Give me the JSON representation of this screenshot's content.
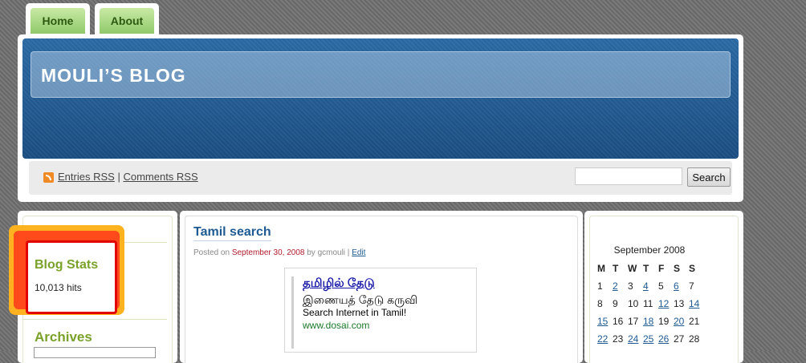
{
  "nav": {
    "tabs": [
      {
        "label": "Home"
      },
      {
        "label": "About"
      }
    ]
  },
  "header": {
    "title": "MOULI’S BLOG",
    "entries_rss": "Entries RSS",
    "separator": "|",
    "comments_rss": "Comments RSS",
    "search_button": "Search",
    "search_placeholder": ""
  },
  "sidebar_left": {
    "stats_title": "Blog Stats",
    "hits": "10,013 hits",
    "archives_title": "Archives"
  },
  "post": {
    "title": "Tamil search",
    "meta_prefix": "Posted on",
    "date": "September 30, 2008",
    "meta_by": "by gcmouli |",
    "edit": "Edit",
    "ad": {
      "title": "தமிழில் தேடு",
      "line1": "இணையத் தேடு கருவி",
      "line2": "Search Internet in Tamil!",
      "url": "www.dosai.com"
    }
  },
  "calendar": {
    "caption": "September 2008",
    "headers": [
      "M",
      "T",
      "W",
      "T",
      "F",
      "S",
      "S"
    ],
    "rows": [
      [
        {
          "d": "1",
          "link": false
        },
        {
          "d": "2",
          "link": true
        },
        {
          "d": "3",
          "link": false
        },
        {
          "d": "4",
          "link": true
        },
        {
          "d": "5",
          "link": false
        },
        {
          "d": "6",
          "link": true
        },
        {
          "d": "7",
          "link": false
        }
      ],
      [
        {
          "d": "8",
          "link": false
        },
        {
          "d": "9",
          "link": false
        },
        {
          "d": "10",
          "link": false
        },
        {
          "d": "11",
          "link": false
        },
        {
          "d": "12",
          "link": true
        },
        {
          "d": "13",
          "link": false
        },
        {
          "d": "14",
          "link": true
        }
      ],
      [
        {
          "d": "15",
          "link": true
        },
        {
          "d": "16",
          "link": false
        },
        {
          "d": "17",
          "link": false
        },
        {
          "d": "18",
          "link": true
        },
        {
          "d": "19",
          "link": false
        },
        {
          "d": "20",
          "link": true
        },
        {
          "d": "21",
          "link": false
        }
      ],
      [
        {
          "d": "22",
          "link": true
        },
        {
          "d": "23",
          "link": false
        },
        {
          "d": "24",
          "link": true
        },
        {
          "d": "25",
          "link": true
        },
        {
          "d": "26",
          "link": true
        },
        {
          "d": "27",
          "link": false
        },
        {
          "d": "28",
          "link": false
        }
      ]
    ]
  }
}
